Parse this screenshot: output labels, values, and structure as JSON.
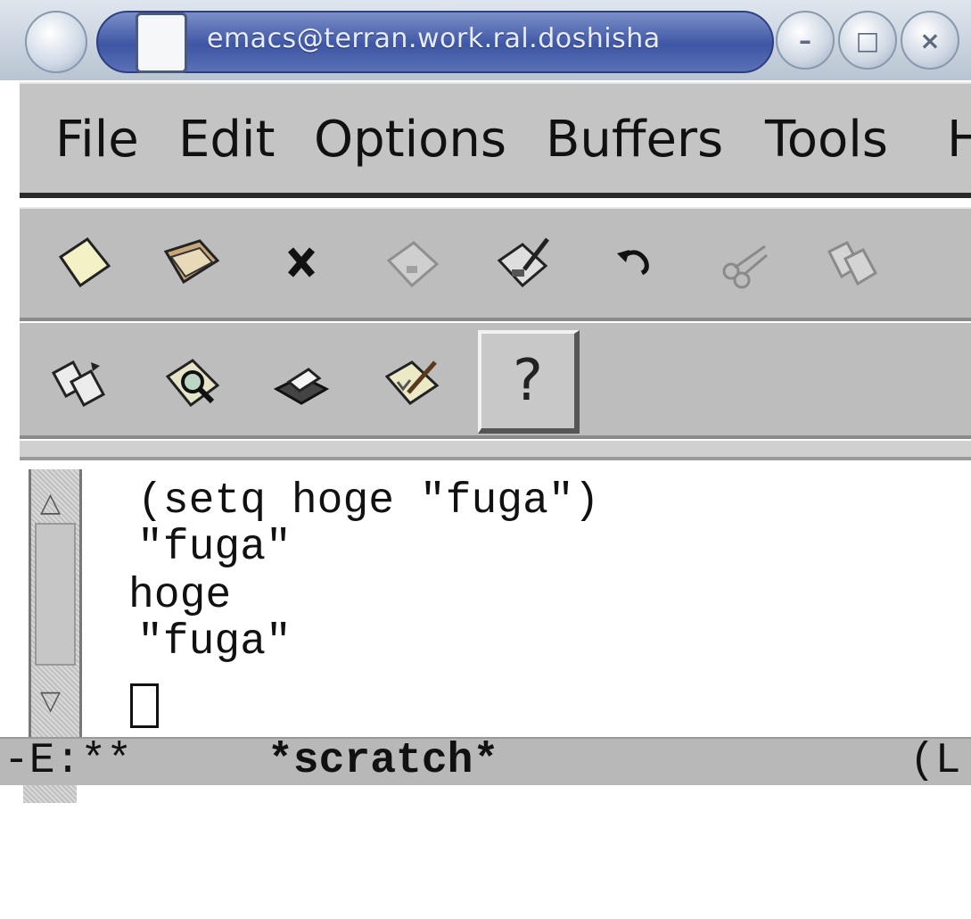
{
  "window": {
    "title": "emacs@terran.work.ral.doshisha",
    "controls": {
      "minimize": "–",
      "maximize": "□",
      "close": "×"
    }
  },
  "menubar": {
    "items": [
      "File",
      "Edit",
      "Options",
      "Buffers",
      "Tools",
      "H"
    ]
  },
  "toolbar": {
    "row1": [
      "new-file-icon",
      "open-folder-icon",
      "close-buffer-icon",
      "save-disk-icon",
      "save-as-icon",
      "undo-icon",
      "cut-icon",
      "copy-icon"
    ],
    "row2": [
      "paste-icon",
      "search-icon",
      "print-icon",
      "spell-check-icon",
      "help-icon"
    ],
    "help_label": "?"
  },
  "buffer": {
    "lines": [
      "(setq hoge \"fuga\")",
      "\"fuga\"",
      "hoge",
      "\"fuga\""
    ]
  },
  "modeline": {
    "flags": "-E:**",
    "buffer_name": "*scratch*",
    "position": "(L"
  },
  "colors": {
    "menubar_bg": "#c4c4c4",
    "toolbar_bg": "#bdbdbd",
    "titlebar_accent": "#3e56a4",
    "modeline_bg": "#b8b8b8"
  }
}
